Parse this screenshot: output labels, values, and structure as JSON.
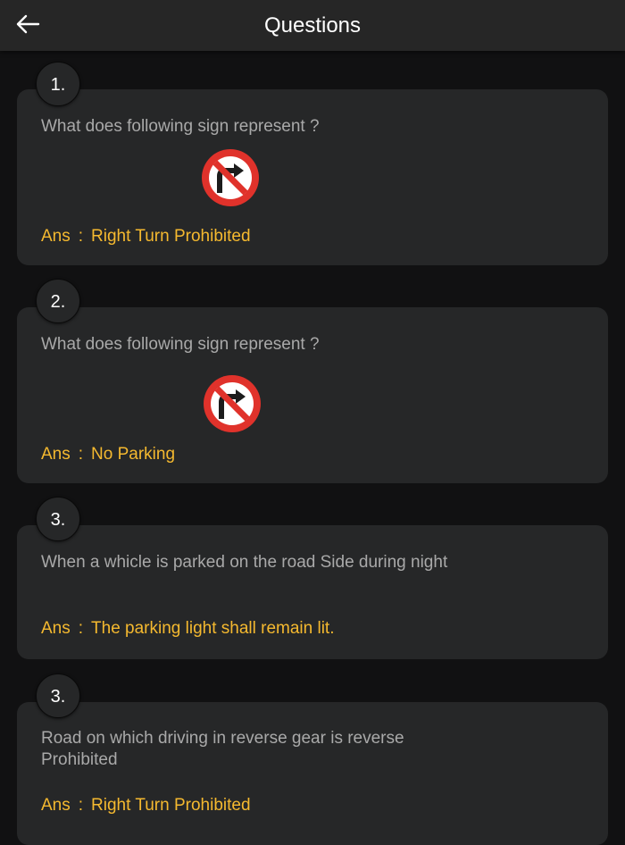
{
  "header": {
    "title": "Questions",
    "back_icon": "arrow-left-icon"
  },
  "colors": {
    "background": "#111112",
    "card": "#262728",
    "answer": "#f5b92f",
    "question": "#a9a9a9",
    "sign_red": "#e0322b"
  },
  "questions": [
    {
      "number": "1.",
      "question": "What does following sign represent ?",
      "sign_icon": "no-right-turn-sign-icon",
      "ans_label": "Ans",
      "separator": ":",
      "answer": "Right Turn Prohibited"
    },
    {
      "number": "2.",
      "question": "What does following sign represent ?",
      "sign_icon": "no-right-turn-sign-icon",
      "ans_label": "Ans",
      "separator": ":",
      "answer": "No Parking"
    },
    {
      "number": "3.",
      "question": "When a whicle is parked on the road Side during night",
      "ans_label": "Ans",
      "separator": ":",
      "answer": "The parking light shall remain lit."
    },
    {
      "number": "3.",
      "question": "Road on which driving in reverse gear is reverse Prohibited",
      "ans_label": "Ans",
      "separator": ":",
      "answer": "Right Turn Prohibited"
    }
  ]
}
